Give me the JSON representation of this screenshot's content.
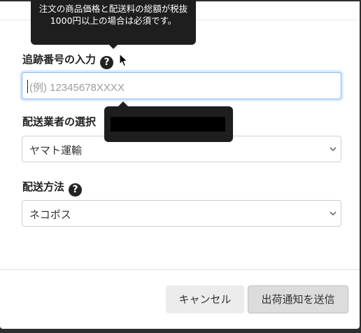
{
  "tooltips": {
    "shipping_fee_note": "注文の商品価格と配送料の総額が税抜1000円以上の場合は必須です。"
  },
  "form": {
    "tracking": {
      "label": "追跡番号の入力",
      "help_icon": "?",
      "placeholder": "(例) 12345678XXXX",
      "value": ""
    },
    "carrier": {
      "label": "配送業者の選択",
      "selected": "ヤマト運輸"
    },
    "method": {
      "label": "配送方法",
      "help_icon": "?",
      "selected": "ネコポス"
    }
  },
  "footer": {
    "cancel_label": "キャンセル",
    "submit_label": "出荷通知を送信"
  },
  "icons": {
    "help": "question-circle-icon",
    "dropdown": "chevron-down-icon",
    "cursor": "mouse-pointer-icon"
  },
  "colors": {
    "tooltip_bg": "#1e1e1e",
    "focus_border": "#7eb6f0",
    "submit_bg": "#dcdcdc",
    "cancel_bg": "#ececec"
  }
}
